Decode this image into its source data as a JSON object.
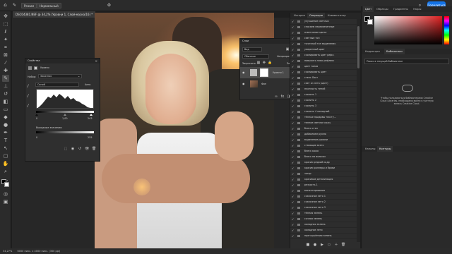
{
  "menubar": {
    "options": [
      "Режим",
      "Нормальный"
    ],
    "share_label": "Поделиться"
  },
  "document": {
    "tab_title": "DSC04381.NEF @ 34,2% (Уровни 1, Слой-маска/16) *"
  },
  "status": {
    "zoom": "34,27%",
    "size": "6000 пикс. x 4000 пикс. (300 ppi)"
  },
  "properties": {
    "title": "Свойства",
    "type_label": "Уровни",
    "preset_label": "Набор:",
    "preset_value": "Заказная",
    "channel_value": "Синий",
    "auto_label": "Авто",
    "input_values": [
      "0",
      "1,00",
      "243"
    ],
    "output_label": "Выходные значения:",
    "output_values": [
      "0",
      "255"
    ]
  },
  "layers": {
    "title": "Слои",
    "search_placeholder": "Вид",
    "blend_mode": "Обычные",
    "opacity_label": "Непрозрачность:",
    "opacity_value": "100%",
    "lock_label": "Закрепить:",
    "fill_label": "Заливка:",
    "fill_value": "100%",
    "items": [
      {
        "name": "Уровни 1"
      },
      {
        "name": "Фон"
      }
    ]
  },
  "history": {
    "tabs": [
      "История",
      "Операции",
      "Комментатор"
    ],
    "items": [
      "улучшение светлых",
      "спасаем пересвеченные",
      "осветление цвета",
      "светлые тон",
      "точечный тон выделения",
      "умеренный цвет",
      "скопировать цвет рефл.",
      "повысить плюс рефлекс",
      "цвет тонов",
      "скопировать цвет",
      "стелс Лист",
      "свет из лета (цвет)",
      "плотность теней",
      "скопить 1",
      "скопить 2",
      "скопить 3",
      "скопить 4 холодный",
      "тёплые придавы тексту...",
      "теплое светлое кожу",
      "блеск стен",
      "добавляем рухлю",
      "выделение руками",
      "ставящие всего",
      "блеск кожа",
      "блеск на волосах",
      "красим редкий кадр",
      "красим роллеры и брови",
      "загар",
      "красивые детализация",
      "резкость 1",
      "монхнтирование",
      "сказочное лето 1",
      "сказочное лето 2",
      "сказочное лето 3",
      "тёплая зелень",
      "сочная зелень",
      "холодная зелень",
      "холодное лето",
      "приглушённая зелень"
    ]
  },
  "color_panel": {
    "tabs": [
      "Цвет",
      "Образцы",
      "Градиенты",
      "Узоры"
    ],
    "hue_color": "#e02020"
  },
  "library": {
    "tabs": [
      "Коррекция",
      "Библиотеки"
    ],
    "search_placeholder": "Поиск в текущей библиотеке",
    "message": "Чтобы пользоваться библиотеками Creative Cloud Libraries, необходимо войти в учетную запись Creative Cloud."
  },
  "bottom_panel": {
    "tabs": [
      "Каналы",
      "Контуры"
    ]
  }
}
